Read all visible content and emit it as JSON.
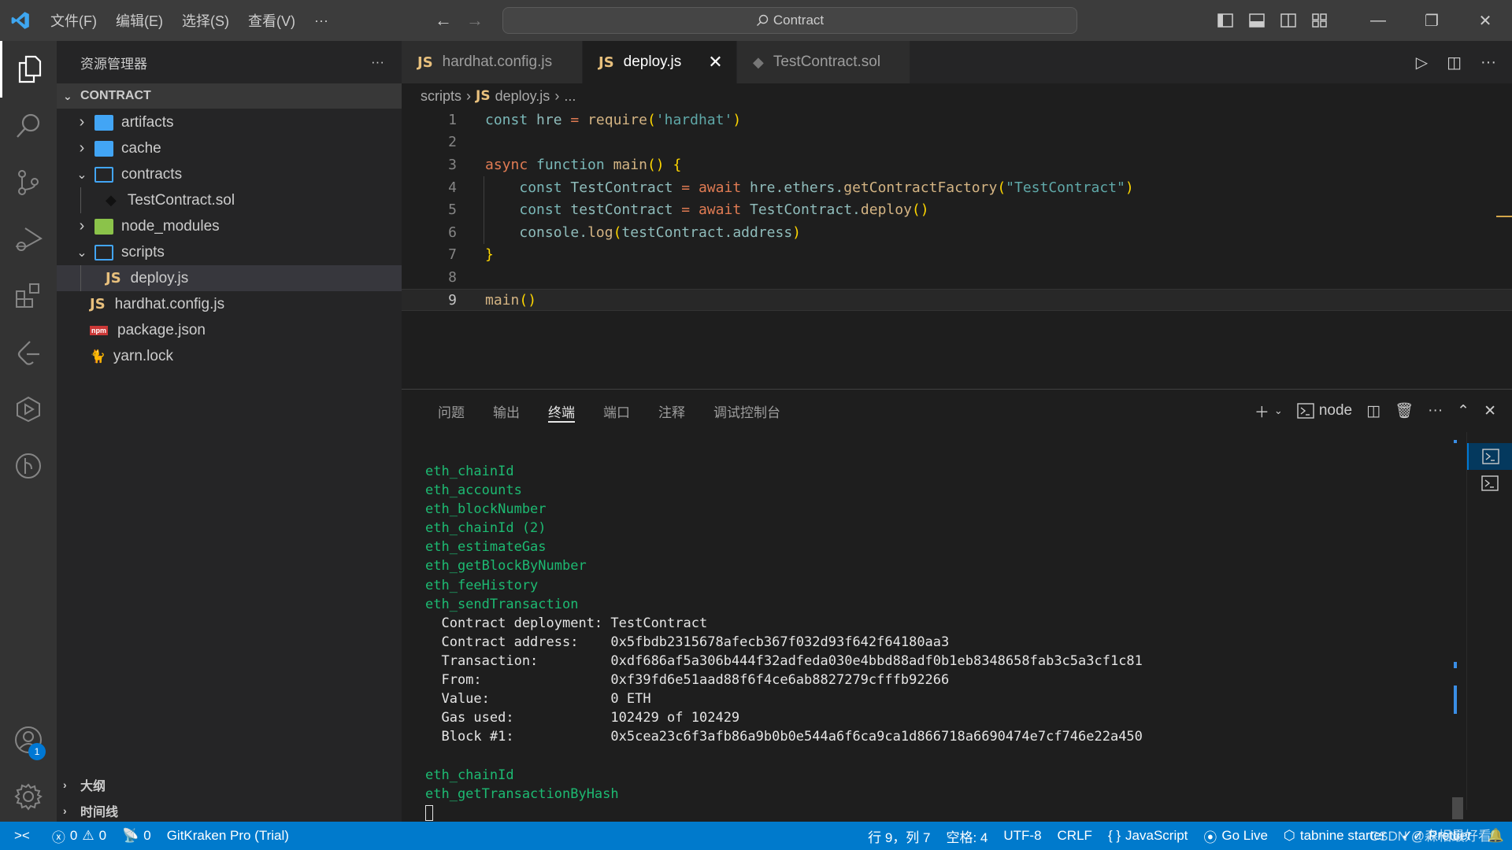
{
  "titlebar": {
    "menus": [
      "文件(F)",
      "编辑(E)",
      "选择(S)",
      "查看(V)",
      "···"
    ],
    "search_text": "Contract"
  },
  "activity_bar": {
    "items": [
      "explorer-icon",
      "search-icon",
      "source-control-icon",
      "run-debug-icon",
      "extensions-icon",
      "gitkraken-icon",
      "testing-icon",
      "git-graph-icon"
    ],
    "account_badge": "1"
  },
  "sidebar": {
    "title": "资源管理器",
    "more": "···",
    "section": "CONTRACT",
    "tree": [
      {
        "label": "artifacts",
        "type": "folder",
        "expanded": false,
        "depth": 0
      },
      {
        "label": "cache",
        "type": "folder",
        "expanded": false,
        "depth": 0
      },
      {
        "label": "contracts",
        "type": "folder",
        "expanded": true,
        "depth": 0
      },
      {
        "label": "TestContract.sol",
        "type": "sol",
        "depth": 1
      },
      {
        "label": "node_modules",
        "type": "node-folder",
        "expanded": false,
        "depth": 0
      },
      {
        "label": "scripts",
        "type": "folder",
        "expanded": true,
        "depth": 0
      },
      {
        "label": "deploy.js",
        "type": "js",
        "depth": 1,
        "selected": true
      },
      {
        "label": "hardhat.config.js",
        "type": "js",
        "depth": 0
      },
      {
        "label": "package.json",
        "type": "npm",
        "depth": 0
      },
      {
        "label": "yarn.lock",
        "type": "yarn",
        "depth": 0
      }
    ],
    "outline_label": "大纲",
    "timeline_label": "时间线"
  },
  "tabs": [
    {
      "label": "hardhat.config.js",
      "icon": "JS",
      "active": false
    },
    {
      "label": "deploy.js",
      "icon": "JS",
      "active": true
    },
    {
      "label": "TestContract.sol",
      "icon": "sol",
      "active": false
    }
  ],
  "breadcrumb": {
    "folder": "scripts",
    "icon": "JS",
    "file": "deploy.js",
    "rest": "..."
  },
  "editor": {
    "current_line": 9,
    "lines": [
      "const hre = require('hardhat')",
      "",
      "async function main() {",
      "    const TestContract = await hre.ethers.getContractFactory(\"TestContract\")",
      "    const testContract = await TestContract.deploy()",
      "    console.log(testContract.address)",
      "}",
      "",
      "main()"
    ]
  },
  "panel": {
    "tabs": [
      "问题",
      "输出",
      "终端",
      "端口",
      "注释",
      "调试控制台"
    ],
    "active_tab": "终端",
    "terminal_name": "node",
    "terminal_output": [
      {
        "text": "eth_chainId",
        "color": "green"
      },
      {
        "text": "eth_accounts",
        "color": "green"
      },
      {
        "text": "eth_blockNumber",
        "color": "green"
      },
      {
        "text": "eth_chainId (2)",
        "color": "green"
      },
      {
        "text": "eth_estimateGas",
        "color": "green"
      },
      {
        "text": "eth_getBlockByNumber",
        "color": "green"
      },
      {
        "text": "eth_feeHistory",
        "color": "green"
      },
      {
        "text": "eth_sendTransaction",
        "color": "green"
      },
      {
        "text": "  Contract deployment: TestContract",
        "color": "white"
      },
      {
        "text": "  Contract address:    0x5fbdb2315678afecb367f032d93f642f64180aa3",
        "color": "white"
      },
      {
        "text": "  Transaction:         0xdf686af5a306b444f32adfeda030e4bbd88adf0b1eb8348658fab3c5a3cf1c81",
        "color": "white"
      },
      {
        "text": "  From:                0xf39fd6e51aad88f6f4ce6ab8827279cfffb92266",
        "color": "white"
      },
      {
        "text": "  Value:               0 ETH",
        "color": "white"
      },
      {
        "text": "  Gas used:            102429 of 102429",
        "color": "white"
      },
      {
        "text": "  Block #1:            0x5cea23c6f3afb86a9b0b0e544a6f6ca9ca1d866718a6690474e7cf746e22a450",
        "color": "white"
      },
      {
        "text": "",
        "color": "white"
      },
      {
        "text": "eth_chainId",
        "color": "green"
      },
      {
        "text": "eth_getTransactionByHash",
        "color": "green"
      }
    ]
  },
  "statusbar": {
    "remote": "><",
    "errors": "0",
    "warnings": "0",
    "ports": "0",
    "gitkraken": "GitKraken Pro (Trial)",
    "position": "行 9，列 7",
    "spaces": "空格: 4",
    "encoding": "UTF-8",
    "eol": "CRLF",
    "language": "JavaScript",
    "golive": "Go Live",
    "tabnine": "tabnine starter",
    "prettier": "Prettier",
    "watermark": "CSDN @森相最好看"
  }
}
